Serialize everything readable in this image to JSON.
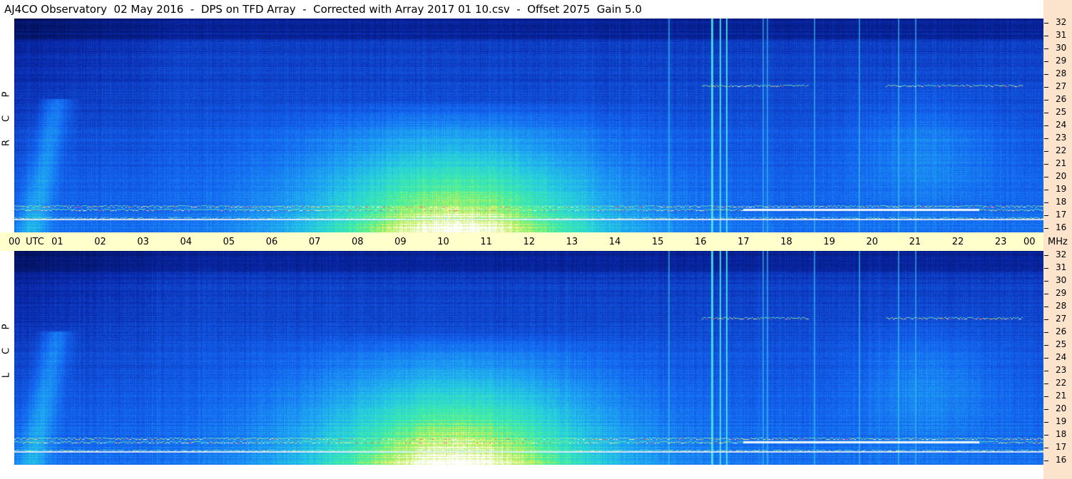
{
  "title": "AJ4CO Observatory  02 May 2016  -  DPS on TFD Array  -  Corrected with Array 2017 01 10.csv  -  Offset 2075  Gain 5.0",
  "chart_data": [
    {
      "type": "heatmap",
      "polarization": [
        "R",
        "C",
        "P"
      ],
      "x_ticks": [
        "00",
        "01",
        "02",
        "03",
        "04",
        "05",
        "06",
        "07",
        "08",
        "09",
        "10",
        "11",
        "12",
        "13",
        "14",
        "15",
        "16",
        "17",
        "18",
        "19",
        "20",
        "21",
        "22",
        "23",
        "00"
      ],
      "x_unit": "UTC",
      "y_ticks": [
        "16",
        "17",
        "18",
        "19",
        "20",
        "21",
        "22",
        "23",
        "24",
        "25",
        "26",
        "27",
        "28",
        "29",
        "30",
        "31",
        "32"
      ],
      "y_unit": "MHz",
      "ylim": [
        16,
        32
      ],
      "xlim_hours": [
        0,
        24
      ],
      "colors": {
        "low": "#000a40",
        "mid": "#1a64f0",
        "high": "#3cf0a0",
        "peak": "#ffffff"
      }
    },
    {
      "type": "heatmap",
      "polarization": [
        "L",
        "C",
        "P"
      ],
      "x_ticks": [
        "00",
        "01",
        "02",
        "03",
        "04",
        "05",
        "06",
        "07",
        "08",
        "09",
        "10",
        "11",
        "12",
        "13",
        "14",
        "15",
        "16",
        "17",
        "18",
        "19",
        "20",
        "21",
        "22",
        "23",
        "00"
      ],
      "x_unit": "UTC",
      "y_ticks": [
        "16",
        "17",
        "18",
        "19",
        "20",
        "21",
        "22",
        "23",
        "24",
        "25",
        "26",
        "27",
        "28",
        "29",
        "30",
        "31",
        "32"
      ],
      "y_unit": "MHz",
      "ylim": [
        16,
        32
      ],
      "xlim_hours": [
        0,
        24
      ]
    }
  ]
}
